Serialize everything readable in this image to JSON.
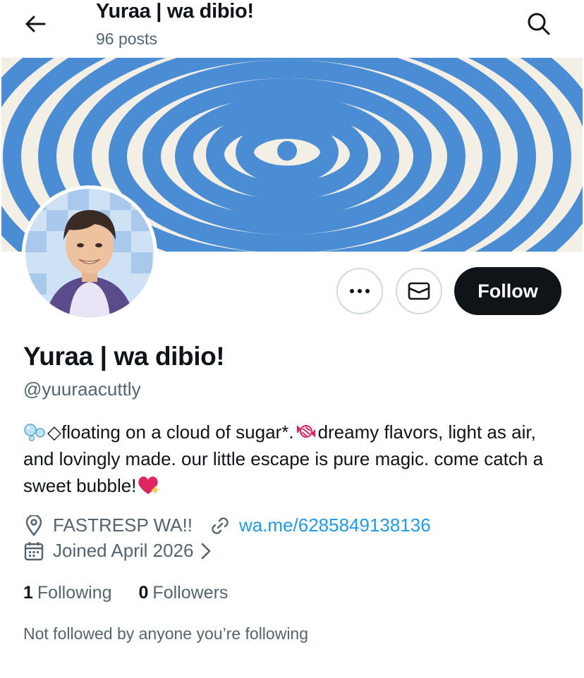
{
  "header": {
    "title": "Yuraa | wa dibio!",
    "posts_count": "96 posts"
  },
  "banner": {
    "pattern": "spiral",
    "stripe_color": "#4b8dd4",
    "background_color": "#f3efe4"
  },
  "profile": {
    "name": "Yuraa | wa dibio!",
    "handle": "@yuuraacuttly",
    "bio_text_1": "◇floating on a cloud of sugar*.",
    "bio_text_2": "dreamy flavors, light as air, and lovingly made. our little escape is pure magic. come catch a sweet bubble!",
    "location": "FASTRESP WA!!",
    "link": "wa.me/6285849138136",
    "joined": "Joined April 2026",
    "not_followed_text": "Not followed by anyone you’re following"
  },
  "actions": {
    "follow_label": "Follow"
  },
  "stats": {
    "following_count": "1",
    "following_label": "Following",
    "followers_count": "0",
    "followers_label": "Followers"
  },
  "icons": {
    "back": "arrow-left-icon",
    "search": "search-icon",
    "more": "more-dots-icon",
    "mail": "envelope-icon",
    "location": "location-pin-icon",
    "link": "link-icon",
    "calendar": "calendar-icon"
  },
  "colors": {
    "accent_link": "#1d9bf0",
    "secondary_text": "#536471",
    "primary_text": "#0f1419",
    "follow_button": "#0f1419"
  }
}
